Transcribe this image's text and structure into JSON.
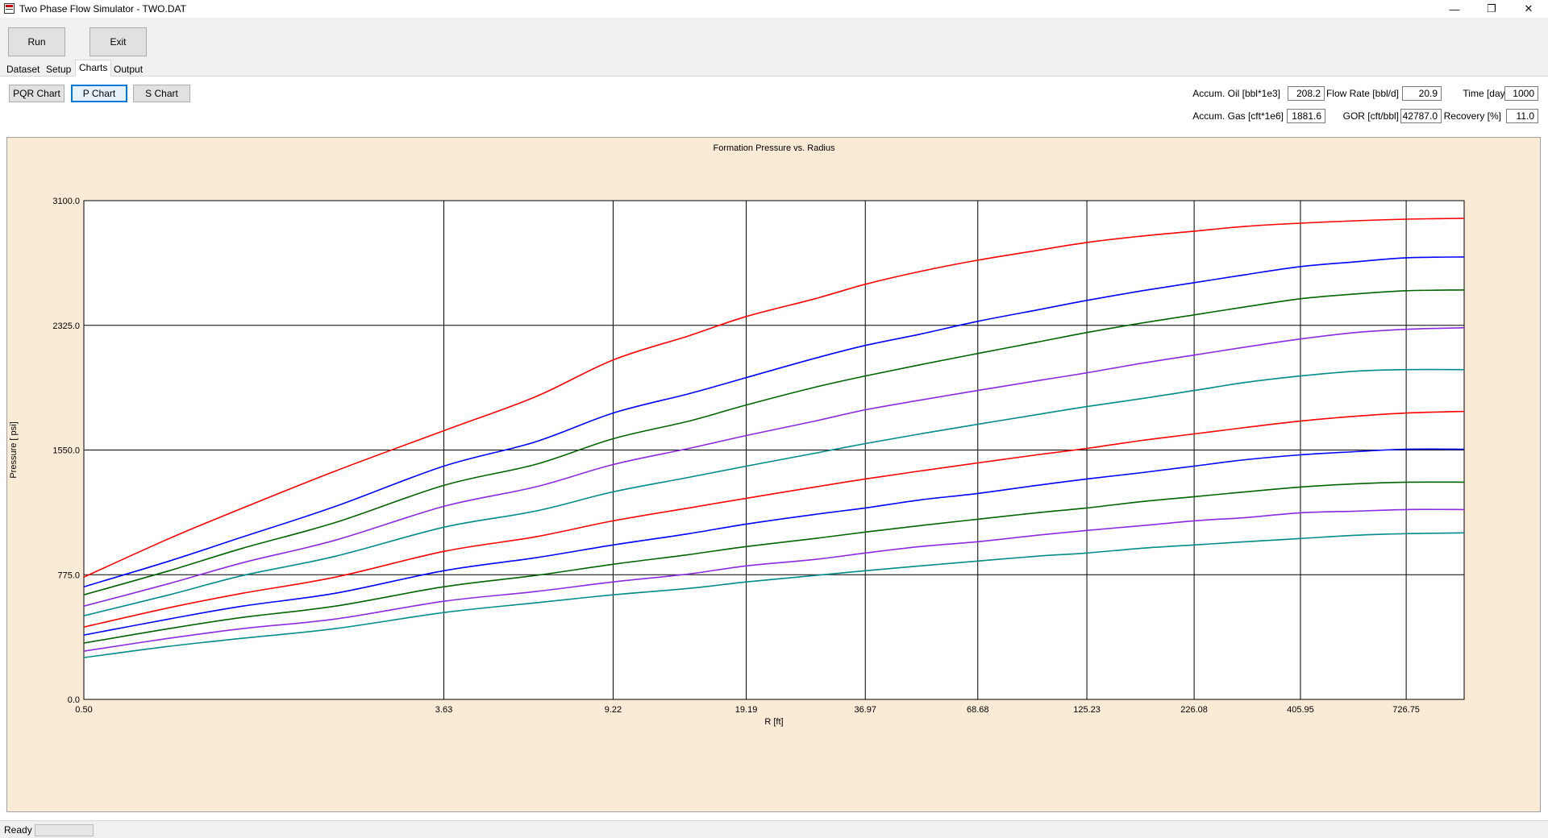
{
  "window": {
    "title": "Two Phase Flow Simulator - TWO.DAT",
    "minimize_glyph": "—",
    "restore_glyph": "❐",
    "close_glyph": "✕"
  },
  "toolbar": {
    "run_label": "Run",
    "exit_label": "Exit"
  },
  "tabs": [
    {
      "label": "Dataset",
      "active": false
    },
    {
      "label": "Setup",
      "active": false
    },
    {
      "label": "Charts",
      "active": true
    },
    {
      "label": "Output",
      "active": false
    }
  ],
  "chart_buttons": [
    {
      "label": "PQR Chart",
      "active": false
    },
    {
      "label": "P Chart",
      "active": true
    },
    {
      "label": "S Chart",
      "active": false
    }
  ],
  "stats": {
    "accum_oil": {
      "label": "Accum. Oil [bbl*1e3]",
      "value": "208.2"
    },
    "flow_rate": {
      "label": "Flow Rate [bbl/d]",
      "value": "20.9"
    },
    "time": {
      "label": "Time [days]",
      "value": "1000"
    },
    "accum_gas": {
      "label": "Accum. Gas [cft*1e6]",
      "value": "1881.6"
    },
    "gor": {
      "label": "GOR [cft/bbl]",
      "value": "42787.0"
    },
    "recovery": {
      "label": "Recovery [%]",
      "value": "11.0"
    }
  },
  "status": {
    "text": "Ready",
    "progress": 0
  },
  "colors": {
    "chart_background": "#faebd7",
    "plot_background": "#ffffff",
    "accent_button_border": "#0078d7",
    "series_palette": [
      "#ff0000",
      "#0000ff",
      "#006400",
      "#8a2be2",
      "#008b8b"
    ]
  },
  "chart_data": {
    "type": "line",
    "title": "Formation Pressure vs. Radius",
    "xlabel": "R [ft]",
    "ylabel": "Pressure [ psi]",
    "x_scale": "log",
    "x_ticks": [
      "0.50",
      "3.63",
      "9.22",
      "19.19",
      "36.97",
      "68.68",
      "125.23",
      "226.08",
      "405.95",
      "726.75"
    ],
    "x_tick_values": [
      0.5,
      3.63,
      9.22,
      19.19,
      36.97,
      68.68,
      125.23,
      226.08,
      405.95,
      726.75
    ],
    "xlim": [
      0.5,
      1000
    ],
    "y_ticks": [
      "0.0",
      "775.0",
      "1550.0",
      "2325.0",
      "3100.0"
    ],
    "y_tick_values": [
      0,
      775,
      1550,
      2325,
      3100
    ],
    "ylim": [
      0,
      3100
    ],
    "grid": true,
    "x": [
      0.5,
      0.8,
      1.2,
      2.0,
      3.63,
      6.0,
      9.22,
      14.0,
      19.19,
      28.0,
      36.97,
      50.0,
      68.68,
      95.0,
      125.23,
      170.0,
      226.08,
      300.0,
      405.95,
      550.0,
      726.75,
      1000
    ],
    "series": [
      {
        "color": "#ff0000",
        "values": [
          760,
          1000,
          1190,
          1420,
          1670,
          1880,
          2110,
          2260,
          2380,
          2490,
          2580,
          2660,
          2730,
          2790,
          2840,
          2880,
          2910,
          2940,
          2960,
          2975,
          2985,
          2990
        ]
      },
      {
        "color": "#0000ff",
        "values": [
          700,
          860,
          1010,
          1200,
          1450,
          1600,
          1780,
          1900,
          2000,
          2120,
          2200,
          2270,
          2350,
          2420,
          2480,
          2540,
          2590,
          2640,
          2690,
          2720,
          2745,
          2750
        ]
      },
      {
        "color": "#006400",
        "values": [
          650,
          800,
          940,
          1100,
          1330,
          1460,
          1620,
          1730,
          1830,
          1940,
          2010,
          2080,
          2150,
          2220,
          2280,
          2340,
          2390,
          2440,
          2490,
          2520,
          2540,
          2545
        ]
      },
      {
        "color": "#8a2be2",
        "values": [
          580,
          720,
          850,
          990,
          1200,
          1320,
          1460,
          1560,
          1640,
          1730,
          1800,
          1860,
          1920,
          1980,
          2030,
          2090,
          2140,
          2190,
          2240,
          2280,
          2300,
          2310
        ]
      },
      {
        "color": "#008b8b",
        "values": [
          520,
          650,
          770,
          890,
          1070,
          1170,
          1290,
          1380,
          1450,
          1530,
          1590,
          1650,
          1710,
          1770,
          1820,
          1870,
          1920,
          1970,
          2010,
          2040,
          2050,
          2050
        ]
      },
      {
        "color": "#ff0000",
        "values": [
          450,
          570,
          660,
          760,
          920,
          1010,
          1110,
          1190,
          1250,
          1320,
          1370,
          1420,
          1470,
          1520,
          1560,
          1610,
          1650,
          1690,
          1730,
          1760,
          1780,
          1790
        ]
      },
      {
        "color": "#0000ff",
        "values": [
          400,
          500,
          580,
          660,
          800,
          880,
          960,
          1030,
          1090,
          1150,
          1190,
          1240,
          1280,
          1330,
          1370,
          1410,
          1450,
          1490,
          1520,
          1540,
          1555,
          1555
        ]
      },
      {
        "color": "#006400",
        "values": [
          350,
          440,
          510,
          580,
          700,
          770,
          840,
          900,
          950,
          1000,
          1040,
          1080,
          1120,
          1160,
          1190,
          1230,
          1260,
          1290,
          1320,
          1340,
          1350,
          1350
        ]
      },
      {
        "color": "#8a2be2",
        "values": [
          300,
          380,
          440,
          500,
          610,
          670,
          730,
          780,
          830,
          870,
          910,
          950,
          980,
          1020,
          1050,
          1080,
          1110,
          1130,
          1160,
          1170,
          1180,
          1180
        ]
      },
      {
        "color": "#008b8b",
        "values": [
          260,
          330,
          380,
          440,
          540,
          600,
          650,
          690,
          730,
          770,
          800,
          830,
          860,
          890,
          910,
          940,
          960,
          980,
          1000,
          1020,
          1030,
          1035
        ]
      }
    ]
  }
}
